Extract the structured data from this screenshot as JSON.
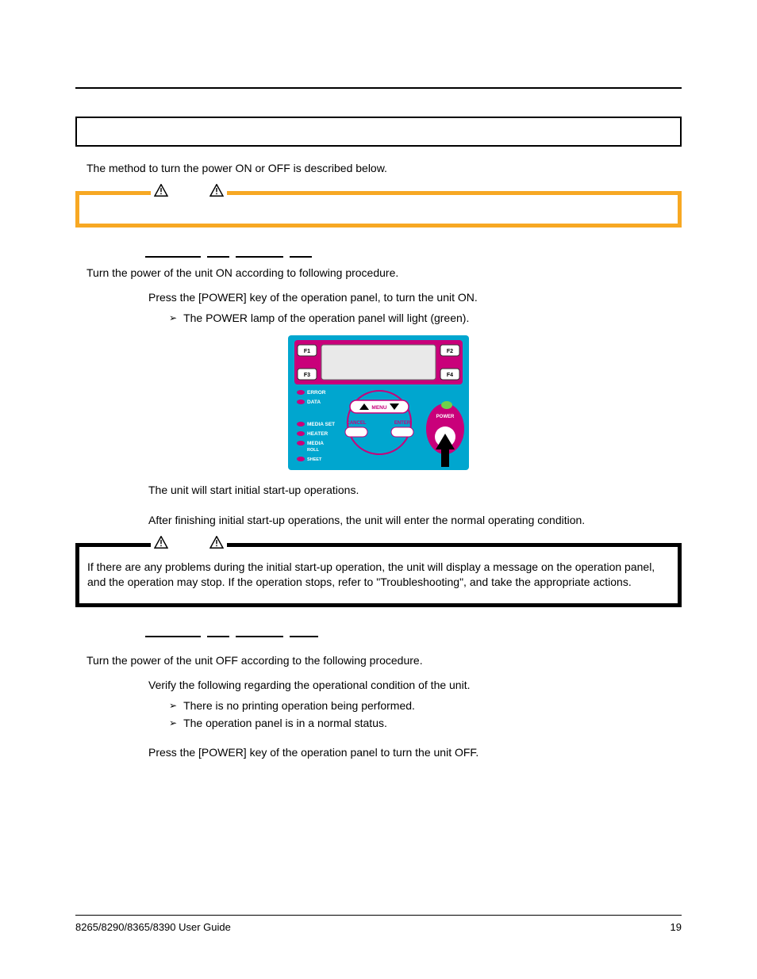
{
  "intro": "The method to turn the power ON or OFF is described below.",
  "power_on": {
    "intro": "Turn the power of the unit ON according to following procedure.",
    "step1": "Press the [POWER] key of the operation panel, to turn the unit ON.",
    "bullet1": "The POWER lamp of the operation panel will light (green).",
    "after1": "The unit will start initial start-up operations.",
    "after2": "After finishing initial start-up operations, the unit will enter the normal operating condition."
  },
  "notes_box": "If there are any problems during the initial start-up operation, the unit will display a message on the operation panel, and the operation may stop.  If the operation stops, refer to \"Troubleshooting\", and take the appropriate actions.",
  "power_off": {
    "intro": "Turn the power of the unit OFF according to the following procedure.",
    "step1": "Verify the following regarding the operational condition of the unit.",
    "bullet1": "There is no printing operation being performed.",
    "bullet2": "The operation panel is in a normal status.",
    "step2": "Press the [POWER] key of the operation panel to turn the unit OFF."
  },
  "panel": {
    "f1": "F1",
    "f2": "F2",
    "f3": "F3",
    "f4": "F4",
    "error": "ERROR",
    "data": "DATA",
    "mediaset": "MEDIA SET",
    "heater": "HEATER",
    "media": "MEDIA",
    "roll": "ROLL",
    "sheet": "SHEET",
    "menu": "MENU",
    "cancel": "CANCEL",
    "enter": "ENTER",
    "power": "POWER"
  },
  "footer": {
    "left": "8265/8290/8365/8390 User Guide",
    "right": "19"
  }
}
